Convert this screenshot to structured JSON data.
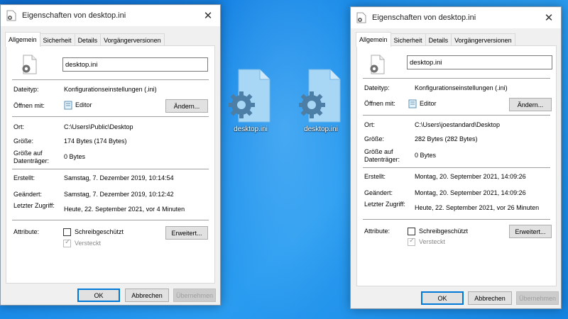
{
  "desktop": {
    "icons": [
      {
        "label": "desktop.ini"
      },
      {
        "label": "desktop.ini"
      }
    ]
  },
  "window_left": {
    "title": "Eigenschaften von desktop.ini",
    "tabs": [
      "Allgemein",
      "Sicherheit",
      "Details",
      "Vorgängerversionen"
    ],
    "active_tab": "Allgemein",
    "filename": "desktop.ini",
    "dateityp_label": "Dateityp:",
    "dateityp_value": "Konfigurationseinstellungen (.ini)",
    "oeffnen_label": "Öffnen mit:",
    "oeffnen_value": "Editor",
    "aendern_button": "Ändern...",
    "ort_label": "Ort:",
    "ort_value": "C:\\Users\\Public\\Desktop",
    "groesse_label": "Größe:",
    "groesse_value": "174 Bytes (174 Bytes)",
    "groesse_auf_label": "Größe auf Datenträger:",
    "groesse_auf_value": "0 Bytes",
    "erstellt_label": "Erstellt:",
    "erstellt_value": "Samstag, 7. Dezember 2019, 10:14:54",
    "geaendert_label": "Geändert:",
    "geaendert_value": "Samstag, 7. Dezember 2019, 10:12:42",
    "zugriff_label": "Letzter Zugriff:",
    "zugriff_value": "Heute, 22. September 2021, vor 4 Minuten",
    "attribute_label": "Attribute:",
    "schreib_label": "Schreibgeschützt",
    "versteckt_label": "Versteckt",
    "erweitert_button": "Erweitert...",
    "ok_button": "OK",
    "abbrechen_button": "Abbrechen",
    "uebernehmen_button": "Übernehmen"
  },
  "window_right": {
    "title": "Eigenschaften von desktop.ini",
    "tabs": [
      "Allgemein",
      "Sicherheit",
      "Details",
      "Vorgängerversionen"
    ],
    "active_tab": "Allgemein",
    "filename": "desktop.ini",
    "dateityp_label": "Dateityp:",
    "dateityp_value": "Konfigurationseinstellungen (.ini)",
    "oeffnen_label": "Öffnen mit:",
    "oeffnen_value": "Editor",
    "aendern_button": "Ändern...",
    "ort_label": "Ort:",
    "ort_value": "C:\\Users\\joestandard\\Desktop",
    "groesse_label": "Größe:",
    "groesse_value": "282 Bytes (282 Bytes)",
    "groesse_auf_label": "Größe auf Datenträger:",
    "groesse_auf_value": "0 Bytes",
    "erstellt_label": "Erstellt:",
    "erstellt_value": "Montag, 20. September 2021, 14:09:26",
    "geaendert_label": "Geändert:",
    "geaendert_value": "Montag, 20. September 2021, 14:09:26",
    "zugriff_label": "Letzter Zugriff:",
    "zugriff_value": "Heute, 22. September 2021, vor 26 Minuten",
    "attribute_label": "Attribute:",
    "schreib_label": "Schreibgeschützt",
    "versteckt_label": "Versteckt",
    "erweitert_button": "Erweitert...",
    "ok_button": "OK",
    "abbrechen_button": "Abbrechen",
    "uebernehmen_button": "Übernehmen"
  },
  "colors": {
    "desktop_blue": "#1a8ae8",
    "window_bg": "#f0f0f0",
    "accent": "#0078d7"
  },
  "icons": [
    "gear-file-icon",
    "editor-icon",
    "close-icon"
  ]
}
